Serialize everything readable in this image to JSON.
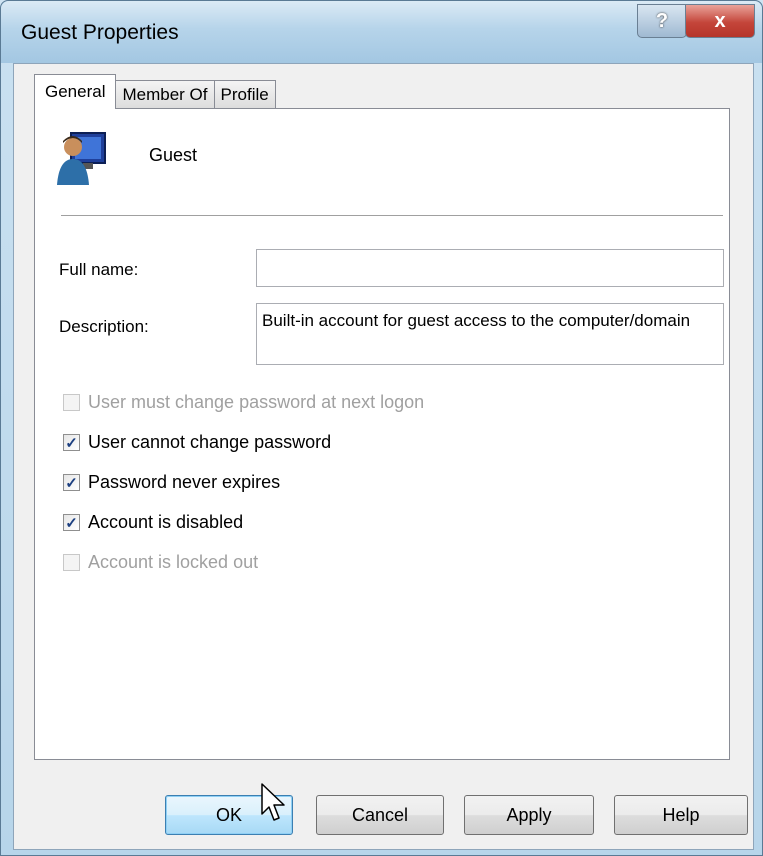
{
  "window": {
    "title": "Guest Properties",
    "help_label": "?",
    "close_label": "x"
  },
  "tabs": [
    {
      "label": "General",
      "active": true
    },
    {
      "label": "Member Of",
      "active": false
    },
    {
      "label": "Profile",
      "active": false
    }
  ],
  "general": {
    "user_icon": "user-monitor-icon",
    "user_name": "Guest",
    "full_name_label": "Full name:",
    "full_name_value": "",
    "description_label": "Description:",
    "description_value": "Built-in account for guest access to the computer/domain"
  },
  "options": [
    {
      "label": "User must change password at next logon",
      "checked": false,
      "enabled": false
    },
    {
      "label": "User cannot change password",
      "checked": true,
      "enabled": true
    },
    {
      "label": "Password never expires",
      "checked": true,
      "enabled": true
    },
    {
      "label": "Account is disabled",
      "checked": true,
      "enabled": true
    },
    {
      "label": "Account is locked out",
      "checked": false,
      "enabled": false
    }
  ],
  "buttons": {
    "ok": "OK",
    "cancel": "Cancel",
    "apply": "Apply",
    "help": "Help"
  }
}
